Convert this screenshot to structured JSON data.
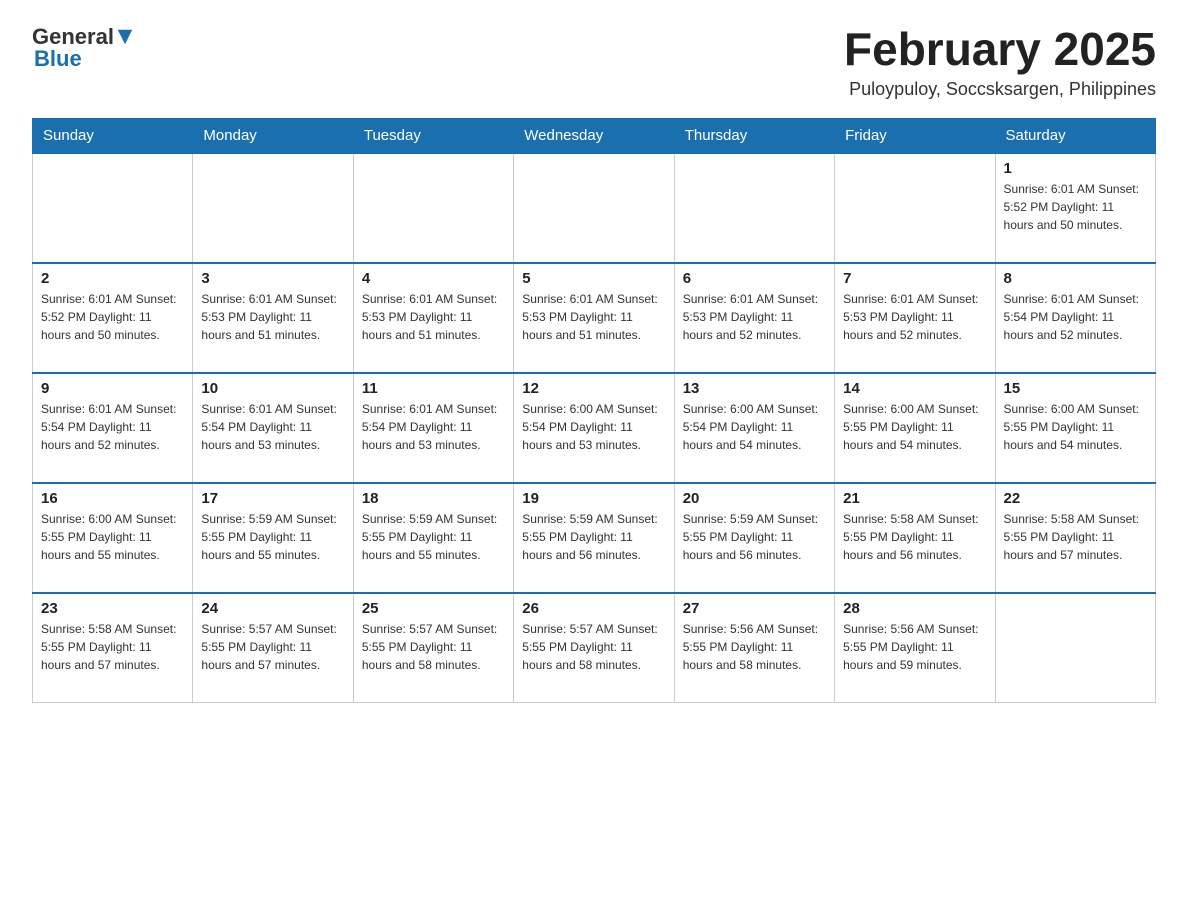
{
  "logo": {
    "general": "General",
    "blue": "Blue"
  },
  "title": "February 2025",
  "subtitle": "Puloypuloy, Soccsksargen, Philippines",
  "weekdays": [
    "Sunday",
    "Monday",
    "Tuesday",
    "Wednesday",
    "Thursday",
    "Friday",
    "Saturday"
  ],
  "weeks": [
    [
      {
        "num": "",
        "info": ""
      },
      {
        "num": "",
        "info": ""
      },
      {
        "num": "",
        "info": ""
      },
      {
        "num": "",
        "info": ""
      },
      {
        "num": "",
        "info": ""
      },
      {
        "num": "",
        "info": ""
      },
      {
        "num": "1",
        "info": "Sunrise: 6:01 AM\nSunset: 5:52 PM\nDaylight: 11 hours\nand 50 minutes."
      }
    ],
    [
      {
        "num": "2",
        "info": "Sunrise: 6:01 AM\nSunset: 5:52 PM\nDaylight: 11 hours\nand 50 minutes."
      },
      {
        "num": "3",
        "info": "Sunrise: 6:01 AM\nSunset: 5:53 PM\nDaylight: 11 hours\nand 51 minutes."
      },
      {
        "num": "4",
        "info": "Sunrise: 6:01 AM\nSunset: 5:53 PM\nDaylight: 11 hours\nand 51 minutes."
      },
      {
        "num": "5",
        "info": "Sunrise: 6:01 AM\nSunset: 5:53 PM\nDaylight: 11 hours\nand 51 minutes."
      },
      {
        "num": "6",
        "info": "Sunrise: 6:01 AM\nSunset: 5:53 PM\nDaylight: 11 hours\nand 52 minutes."
      },
      {
        "num": "7",
        "info": "Sunrise: 6:01 AM\nSunset: 5:53 PM\nDaylight: 11 hours\nand 52 minutes."
      },
      {
        "num": "8",
        "info": "Sunrise: 6:01 AM\nSunset: 5:54 PM\nDaylight: 11 hours\nand 52 minutes."
      }
    ],
    [
      {
        "num": "9",
        "info": "Sunrise: 6:01 AM\nSunset: 5:54 PM\nDaylight: 11 hours\nand 52 minutes."
      },
      {
        "num": "10",
        "info": "Sunrise: 6:01 AM\nSunset: 5:54 PM\nDaylight: 11 hours\nand 53 minutes."
      },
      {
        "num": "11",
        "info": "Sunrise: 6:01 AM\nSunset: 5:54 PM\nDaylight: 11 hours\nand 53 minutes."
      },
      {
        "num": "12",
        "info": "Sunrise: 6:00 AM\nSunset: 5:54 PM\nDaylight: 11 hours\nand 53 minutes."
      },
      {
        "num": "13",
        "info": "Sunrise: 6:00 AM\nSunset: 5:54 PM\nDaylight: 11 hours\nand 54 minutes."
      },
      {
        "num": "14",
        "info": "Sunrise: 6:00 AM\nSunset: 5:55 PM\nDaylight: 11 hours\nand 54 minutes."
      },
      {
        "num": "15",
        "info": "Sunrise: 6:00 AM\nSunset: 5:55 PM\nDaylight: 11 hours\nand 54 minutes."
      }
    ],
    [
      {
        "num": "16",
        "info": "Sunrise: 6:00 AM\nSunset: 5:55 PM\nDaylight: 11 hours\nand 55 minutes."
      },
      {
        "num": "17",
        "info": "Sunrise: 5:59 AM\nSunset: 5:55 PM\nDaylight: 11 hours\nand 55 minutes."
      },
      {
        "num": "18",
        "info": "Sunrise: 5:59 AM\nSunset: 5:55 PM\nDaylight: 11 hours\nand 55 minutes."
      },
      {
        "num": "19",
        "info": "Sunrise: 5:59 AM\nSunset: 5:55 PM\nDaylight: 11 hours\nand 56 minutes."
      },
      {
        "num": "20",
        "info": "Sunrise: 5:59 AM\nSunset: 5:55 PM\nDaylight: 11 hours\nand 56 minutes."
      },
      {
        "num": "21",
        "info": "Sunrise: 5:58 AM\nSunset: 5:55 PM\nDaylight: 11 hours\nand 56 minutes."
      },
      {
        "num": "22",
        "info": "Sunrise: 5:58 AM\nSunset: 5:55 PM\nDaylight: 11 hours\nand 57 minutes."
      }
    ],
    [
      {
        "num": "23",
        "info": "Sunrise: 5:58 AM\nSunset: 5:55 PM\nDaylight: 11 hours\nand 57 minutes."
      },
      {
        "num": "24",
        "info": "Sunrise: 5:57 AM\nSunset: 5:55 PM\nDaylight: 11 hours\nand 57 minutes."
      },
      {
        "num": "25",
        "info": "Sunrise: 5:57 AM\nSunset: 5:55 PM\nDaylight: 11 hours\nand 58 minutes."
      },
      {
        "num": "26",
        "info": "Sunrise: 5:57 AM\nSunset: 5:55 PM\nDaylight: 11 hours\nand 58 minutes."
      },
      {
        "num": "27",
        "info": "Sunrise: 5:56 AM\nSunset: 5:55 PM\nDaylight: 11 hours\nand 58 minutes."
      },
      {
        "num": "28",
        "info": "Sunrise: 5:56 AM\nSunset: 5:55 PM\nDaylight: 11 hours\nand 59 minutes."
      },
      {
        "num": "",
        "info": ""
      }
    ]
  ]
}
